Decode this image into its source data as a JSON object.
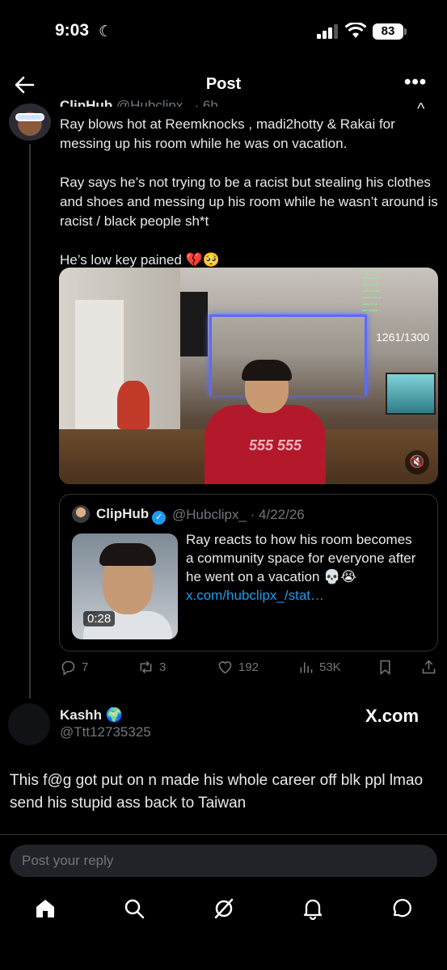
{
  "status": {
    "time": "9:03",
    "battery": "83"
  },
  "header": {
    "title": "Post"
  },
  "tweet": {
    "name_cut": "ClipHub",
    "handle_cut": "@Hubclipx_ · 6h",
    "paragraphs": [
      "Ray blows hot at Reemknocks , madi2hotty & Rakai for messing up his room while he was on vacation.",
      "Ray says he’s not trying to be a racist but stealing his clothes and shoes and messing up his room while he wasn’t around is racist / black people sh*t",
      "He’s low key pained 💔🥺"
    ],
    "video": {
      "viewer_count": "1261/1300",
      "shirt_print": "555 555"
    },
    "quote": {
      "name": "ClipHub",
      "handle_date": "@Hubclipx_ · 4/22/26",
      "text": "Ray reacts to how his room becomes a community space for everyone after he went on a vacation 💀😭",
      "link": "x.com/hubclipx_/stat…",
      "duration": "0:28"
    },
    "actions": {
      "replies": "7",
      "reposts": "3",
      "likes": "192",
      "views": "53K"
    }
  },
  "reply": {
    "name": "Kashh",
    "handle": "@Ttt12735325",
    "text": "This f@g got put on n made his whole career off blk ppl lmao send his stupid ass back to Taiwan",
    "watermark": "X.com"
  },
  "composer": {
    "placeholder": "Post your reply"
  },
  "colors": {
    "accent": "#1d9bf0",
    "muted": "#71767b",
    "background": "#000000"
  }
}
